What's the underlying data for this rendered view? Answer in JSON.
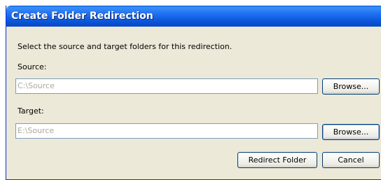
{
  "window": {
    "title": "Create Folder Redirection"
  },
  "content": {
    "instructions": "Select the source and target folders for this redirection.",
    "source": {
      "label": "Source:",
      "value": "C:\\Source",
      "browse_label": "Browse..."
    },
    "target": {
      "label": "Target:",
      "value": "E:\\Source",
      "browse_label": "Browse..."
    }
  },
  "buttons": {
    "redirect_label": "Redirect Folder",
    "cancel_label": "Cancel"
  },
  "colors": {
    "titlebar": "#0a55d8",
    "dialog_background": "#ece9d8",
    "field_border": "#7f9db9",
    "button_border": "#003c74",
    "disabled_text": "#aca899"
  }
}
